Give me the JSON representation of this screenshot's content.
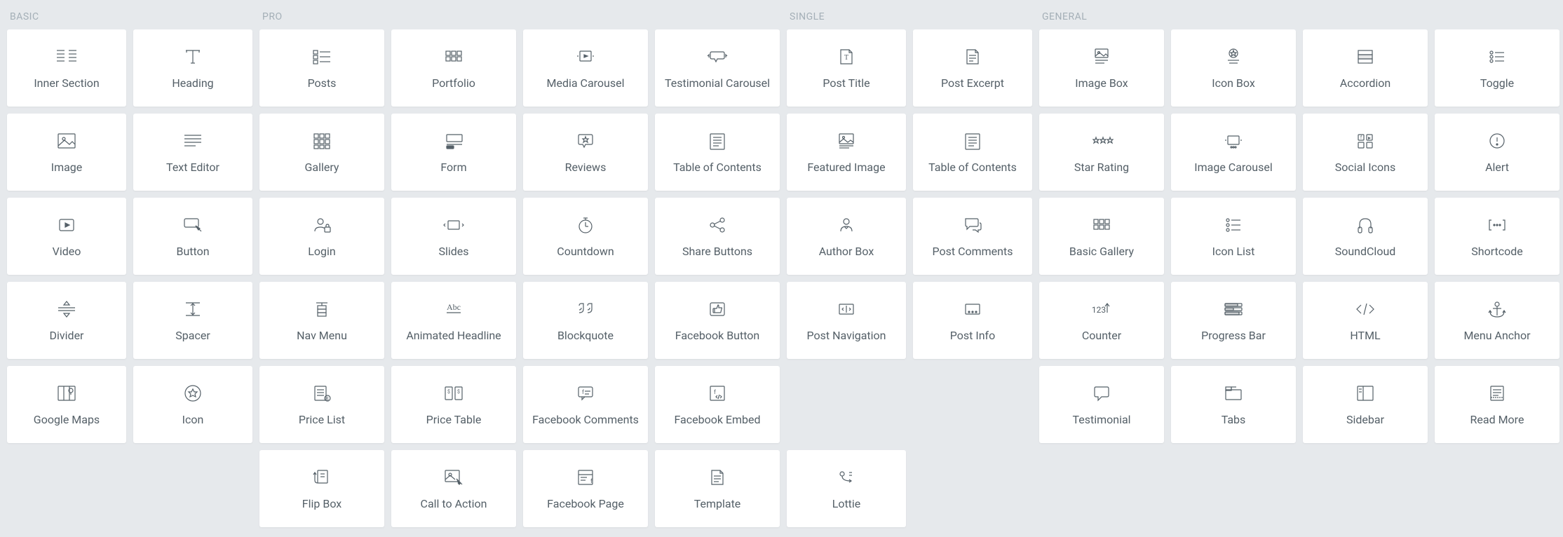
{
  "sections": {
    "basic": {
      "title": "BASIC",
      "items": [
        {
          "label": "Inner Section",
          "icon": "columns"
        },
        {
          "label": "Heading",
          "icon": "heading"
        },
        {
          "label": "Image",
          "icon": "image"
        },
        {
          "label": "Text Editor",
          "icon": "text-editor"
        },
        {
          "label": "Video",
          "icon": "video"
        },
        {
          "label": "Button",
          "icon": "button"
        },
        {
          "label": "Divider",
          "icon": "divider"
        },
        {
          "label": "Spacer",
          "icon": "spacer"
        },
        {
          "label": "Google Maps",
          "icon": "map"
        },
        {
          "label": "Icon",
          "icon": "star-circle"
        }
      ]
    },
    "pro": {
      "title": "PRO",
      "items": [
        {
          "label": "Posts",
          "icon": "posts"
        },
        {
          "label": "Portfolio",
          "icon": "grid6"
        },
        {
          "label": "Media Carousel",
          "icon": "media-carousel"
        },
        {
          "label": "Testimonial Carousel",
          "icon": "speech-arrows"
        },
        {
          "label": "Gallery",
          "icon": "grid9"
        },
        {
          "label": "Form",
          "icon": "form"
        },
        {
          "label": "Reviews",
          "icon": "star-speech"
        },
        {
          "label": "Table of Contents",
          "icon": "toc"
        },
        {
          "label": "Login",
          "icon": "user-lock"
        },
        {
          "label": "Slides",
          "icon": "slides"
        },
        {
          "label": "Countdown",
          "icon": "stopwatch"
        },
        {
          "label": "Share Buttons",
          "icon": "share"
        },
        {
          "label": "Nav Menu",
          "icon": "nav-menu"
        },
        {
          "label": "Animated Headline",
          "icon": "abc"
        },
        {
          "label": "Blockquote",
          "icon": "quote"
        },
        {
          "label": "Facebook Button",
          "icon": "thumb"
        },
        {
          "label": "Price List",
          "icon": "price-list"
        },
        {
          "label": "Price Table",
          "icon": "price-table"
        },
        {
          "label": "Facebook Comments",
          "icon": "fb-comments"
        },
        {
          "label": "Facebook Embed",
          "icon": "fb-embed"
        },
        {
          "label": "Flip Box",
          "icon": "flip-box"
        },
        {
          "label": "Call to Action",
          "icon": "cta"
        },
        {
          "label": "Facebook Page",
          "icon": "fb-page"
        },
        {
          "label": "Template",
          "icon": "template"
        }
      ]
    },
    "single": {
      "title": "SINGLE",
      "items": [
        {
          "label": "Post Title",
          "icon": "post-title"
        },
        {
          "label": "Post Excerpt",
          "icon": "post-excerpt"
        },
        {
          "label": "Featured Image",
          "icon": "featured-image"
        },
        {
          "label": "Table of Contents",
          "icon": "toc"
        },
        {
          "label": "Author Box",
          "icon": "author"
        },
        {
          "label": "Post Comments",
          "icon": "comments"
        },
        {
          "label": "Post Navigation",
          "icon": "post-nav"
        },
        {
          "label": "Post Info",
          "icon": "post-info"
        },
        {
          "label": "Lottie",
          "icon": "lottie"
        }
      ]
    },
    "general": {
      "title": "GENERAL",
      "items": [
        {
          "label": "Image Box",
          "icon": "image-box"
        },
        {
          "label": "Icon Box",
          "icon": "icon-box"
        },
        {
          "label": "Accordion",
          "icon": "accordion"
        },
        {
          "label": "Toggle",
          "icon": "toggle"
        },
        {
          "label": "Star Rating",
          "icon": "stars"
        },
        {
          "label": "Image Carousel",
          "icon": "img-carousel"
        },
        {
          "label": "Social Icons",
          "icon": "social"
        },
        {
          "label": "Alert",
          "icon": "alert"
        },
        {
          "label": "Basic Gallery",
          "icon": "grid6"
        },
        {
          "label": "Icon List",
          "icon": "icon-list"
        },
        {
          "label": "SoundCloud",
          "icon": "headphones"
        },
        {
          "label": "Shortcode",
          "icon": "shortcode"
        },
        {
          "label": "Counter",
          "icon": "counter"
        },
        {
          "label": "Progress Bar",
          "icon": "progress"
        },
        {
          "label": "HTML",
          "icon": "code"
        },
        {
          "label": "Menu Anchor",
          "icon": "anchor"
        },
        {
          "label": "Testimonial",
          "icon": "speech"
        },
        {
          "label": "Tabs",
          "icon": "tabs"
        },
        {
          "label": "Sidebar",
          "icon": "sidebar"
        },
        {
          "label": "Read More",
          "icon": "read-more"
        }
      ]
    }
  }
}
